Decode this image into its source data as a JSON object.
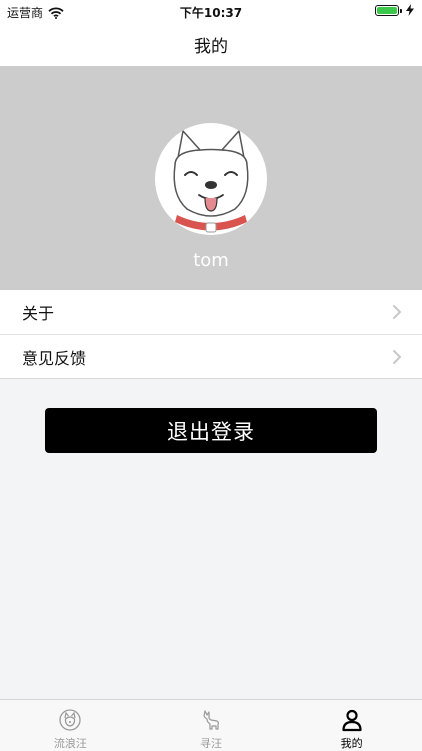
{
  "status_bar": {
    "carrier": "运营商",
    "time": "下午10:37",
    "battery_color": "#3cc84b"
  },
  "nav": {
    "title": "我的"
  },
  "profile": {
    "username": "tom",
    "header_color": "#cccccc"
  },
  "menu": {
    "items": [
      {
        "label": "关于",
        "icon": "chevron-right-icon"
      },
      {
        "label": "意见反馈",
        "icon": "chevron-right-icon"
      }
    ]
  },
  "logout": {
    "label": "退出登录"
  },
  "tabs": [
    {
      "label": "流浪汪",
      "icon": "dog-face-icon",
      "active": false
    },
    {
      "label": "寻汪",
      "icon": "dog-silhouette-icon",
      "active": false
    },
    {
      "label": "我的",
      "icon": "person-icon",
      "active": true
    }
  ]
}
